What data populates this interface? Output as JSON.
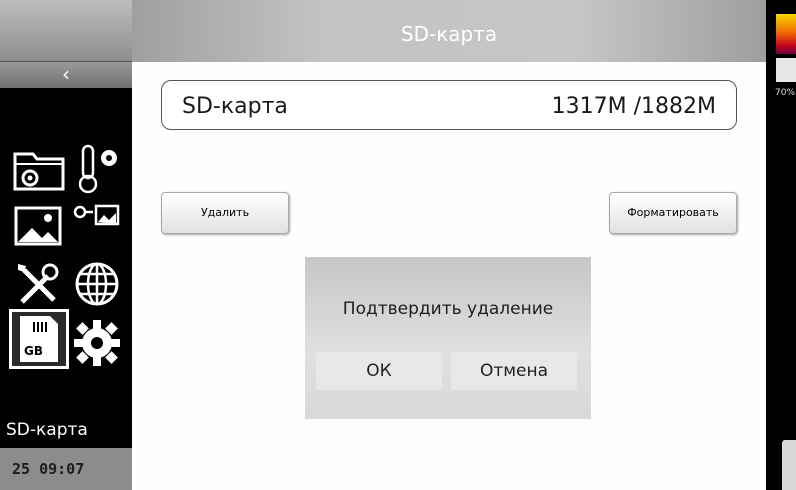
{
  "header": {
    "title": "SD-карта"
  },
  "sidebar": {
    "back_label": "‹",
    "icons": [
      {
        "name": "folder-gear-icon"
      },
      {
        "name": "thermometer-gear-icon"
      },
      {
        "name": "image-icon"
      },
      {
        "name": "picture-in-picture-icon"
      },
      {
        "name": "tools-icon"
      },
      {
        "name": "globe-icon"
      },
      {
        "name": "sd-card-icon",
        "badge": "GB",
        "selected": true
      },
      {
        "name": "gear-icon"
      }
    ],
    "current_section": "SD-карта",
    "date_time": "25 09:07"
  },
  "storage": {
    "label": "SD-карта",
    "usage": "1317M /1882M"
  },
  "actions": {
    "delete_label": "Удалить",
    "format_label": "Форматировать"
  },
  "dialog": {
    "message": "Подтвердить удаление",
    "ok_label": "ОК",
    "cancel_label": "Отмена"
  },
  "right_panel": {
    "percent": "70%",
    "palette_colors": [
      "#f6d800",
      "#f06d00",
      "#c40020",
      "#6a0040"
    ]
  }
}
